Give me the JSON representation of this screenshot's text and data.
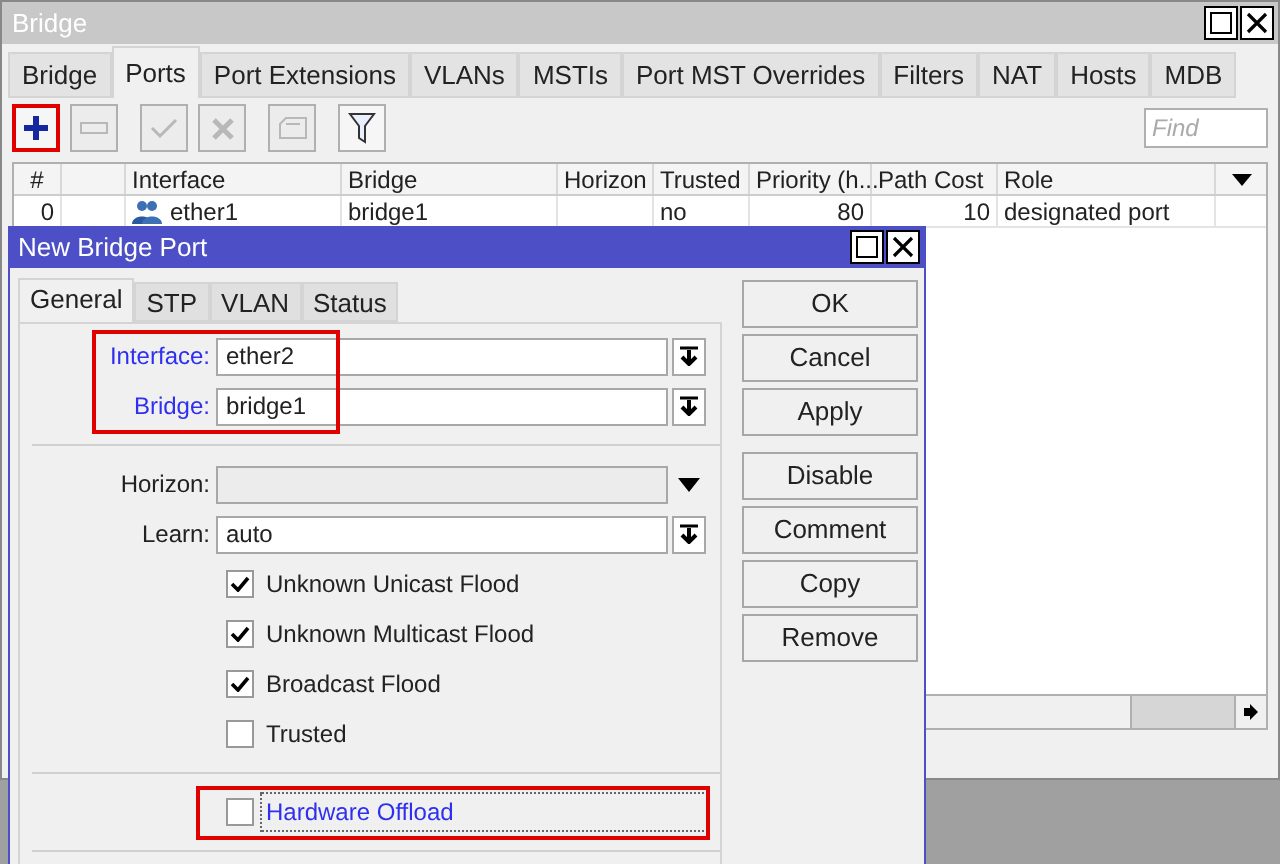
{
  "window": {
    "title": "Bridge"
  },
  "tabs": [
    {
      "label": "Bridge",
      "selected": false
    },
    {
      "label": "Ports",
      "selected": true
    },
    {
      "label": "Port Extensions",
      "selected": false
    },
    {
      "label": "VLANs",
      "selected": false
    },
    {
      "label": "MSTIs",
      "selected": false
    },
    {
      "label": "Port MST Overrides",
      "selected": false
    },
    {
      "label": "Filters",
      "selected": false
    },
    {
      "label": "NAT",
      "selected": false
    },
    {
      "label": "Hosts",
      "selected": false
    },
    {
      "label": "MDB",
      "selected": false
    }
  ],
  "toolbar": {
    "buttons": [
      {
        "kind": "add",
        "disabled": false,
        "highlighted": true
      },
      {
        "kind": "remove",
        "disabled": true,
        "highlighted": false
      },
      {
        "kind": "enable",
        "disabled": true,
        "highlighted": false
      },
      {
        "kind": "disable",
        "disabled": true,
        "highlighted": false
      },
      {
        "kind": "comment",
        "disabled": true,
        "highlighted": false
      },
      {
        "kind": "filter",
        "disabled": false,
        "highlighted": false
      }
    ],
    "search": {
      "placeholder": "Find"
    }
  },
  "table": {
    "columns": [
      {
        "kind": "text",
        "label": "#"
      },
      {
        "kind": "flags"
      },
      {
        "kind": "text",
        "label": "Interface"
      },
      {
        "kind": "text",
        "label": "Bridge"
      },
      {
        "kind": "text",
        "label": "Horizon"
      },
      {
        "kind": "text",
        "label": "Trusted"
      },
      {
        "kind": "text",
        "label": "Priority (h..."
      },
      {
        "kind": "text",
        "label": "Path Cost"
      },
      {
        "kind": "text",
        "label": "Role"
      }
    ],
    "rows": [
      {
        "number": "0",
        "interface": "ether1",
        "bridge": "bridge1",
        "trusted": "no",
        "priority": "80",
        "path_cost": "10",
        "role": "designated port"
      }
    ]
  },
  "dialog": {
    "title": "New Bridge Port",
    "tabs": [
      {
        "label": "General",
        "selected": true
      },
      {
        "label": "STP",
        "selected": false
      },
      {
        "label": "VLAN",
        "selected": false
      },
      {
        "label": "Status",
        "selected": false
      }
    ],
    "fields": [
      {
        "kind": "combo",
        "label": "Interface:",
        "value": "ether2",
        "required": true,
        "highlighted": true
      },
      {
        "kind": "combo",
        "label": "Bridge:",
        "value": "bridge1",
        "required": true,
        "highlighted": true
      },
      {
        "kind": "separator"
      },
      {
        "kind": "dropdown",
        "label": "Horizon:",
        "disabled": true
      },
      {
        "kind": "combo",
        "label": "Learn:",
        "value": "auto",
        "required": false
      },
      {
        "kind": "checkbox",
        "label": "Unknown Unicast Flood",
        "checked": true,
        "focused": false
      },
      {
        "kind": "checkbox",
        "label": "Unknown Multicast Flood",
        "checked": true,
        "focused": false
      },
      {
        "kind": "checkbox",
        "label": "Broadcast Flood",
        "checked": true,
        "focused": false
      },
      {
        "kind": "checkbox",
        "label": "Trusted",
        "checked": false,
        "focused": false
      },
      {
        "kind": "separator"
      },
      {
        "kind": "checkbox",
        "label": "Hardware Offload",
        "checked": false,
        "focused": true,
        "highlighted": true
      },
      {
        "kind": "separator"
      }
    ],
    "button_groups": [
      [
        "OK",
        "Cancel",
        "Apply"
      ],
      [
        "Disable",
        "Comment",
        "Copy",
        "Remove"
      ]
    ]
  }
}
